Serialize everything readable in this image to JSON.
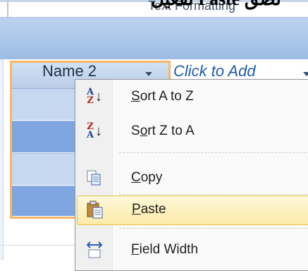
{
  "document": {
    "caption_text": "تفعيل Paste لصق",
    "ribbon_partial_text": "Text Formatting"
  },
  "datasheet": {
    "selected_column": {
      "header": "Name 2"
    },
    "add_column": {
      "header": "Click to Add"
    },
    "row_count_visible": 4
  },
  "context_menu": {
    "items": [
      {
        "label": "Sort A to Z",
        "icon": "sort-a-to-z-icon"
      },
      {
        "label": "Sort Z to A",
        "icon": "sort-z-to-a-icon"
      },
      {
        "label": "Copy",
        "icon": "copy-icon"
      },
      {
        "label": "Paste",
        "icon": "paste-icon",
        "highlighted": true
      },
      {
        "label": "Field Width",
        "icon": "field-width-icon"
      }
    ]
  },
  "colors": {
    "selection_border": "#f7b765",
    "hover_highlight": "#fbeaa8",
    "row_dark": "#7fa6e0",
    "row_light": "#c6d8f0"
  }
}
